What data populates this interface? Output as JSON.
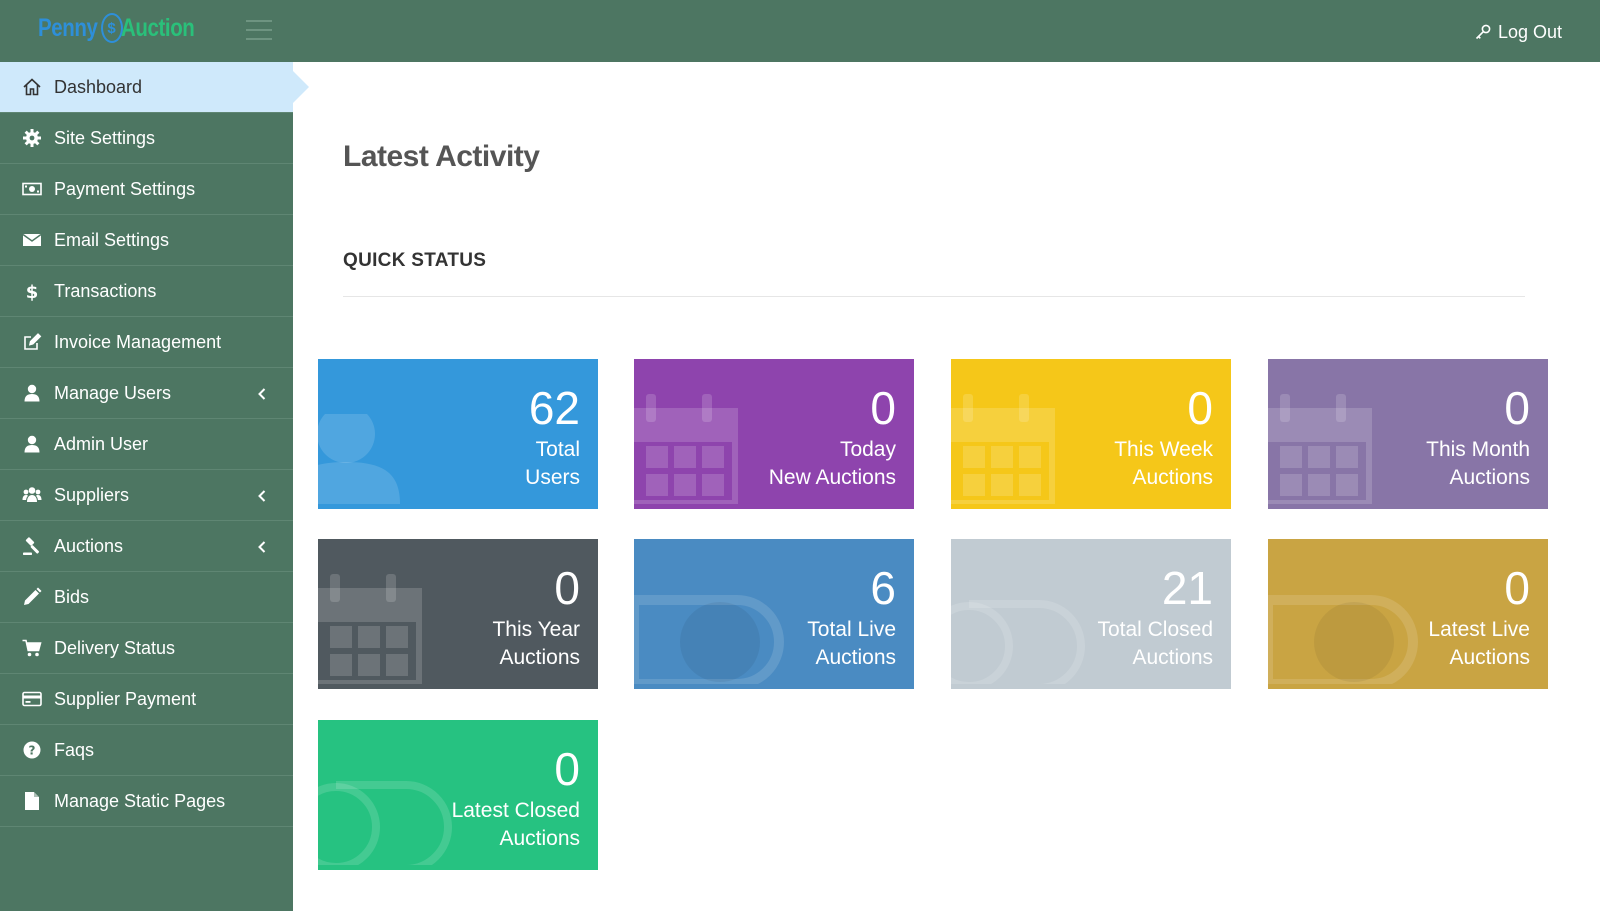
{
  "app": {
    "logo": {
      "word1": "Penny",
      "coin": "$",
      "word2": "Auction"
    },
    "logout_label": "Log Out"
  },
  "sidebar": {
    "items": [
      {
        "label": "Dashboard",
        "icon": "home-icon",
        "active": true,
        "has_submenu": false
      },
      {
        "label": "Site Settings",
        "icon": "gear-icon",
        "active": false,
        "has_submenu": false
      },
      {
        "label": "Payment Settings",
        "icon": "money-icon",
        "active": false,
        "has_submenu": false
      },
      {
        "label": "Email Settings",
        "icon": "envelope-icon",
        "active": false,
        "has_submenu": false
      },
      {
        "label": "Transactions",
        "icon": "dollar-icon",
        "active": false,
        "has_submenu": false
      },
      {
        "label": "Invoice Management",
        "icon": "edit-icon",
        "active": false,
        "has_submenu": false
      },
      {
        "label": "Manage Users",
        "icon": "user-icon",
        "active": false,
        "has_submenu": true
      },
      {
        "label": "Admin User",
        "icon": "user-icon",
        "active": false,
        "has_submenu": false
      },
      {
        "label": "Suppliers",
        "icon": "users-icon",
        "active": false,
        "has_submenu": true
      },
      {
        "label": "Auctions",
        "icon": "gavel-icon",
        "active": false,
        "has_submenu": true
      },
      {
        "label": "Bids",
        "icon": "pencil-icon",
        "active": false,
        "has_submenu": false
      },
      {
        "label": "Delivery Status",
        "icon": "cart-icon",
        "active": false,
        "has_submenu": false
      },
      {
        "label": "Supplier Payment",
        "icon": "credit-card-icon",
        "active": false,
        "has_submenu": false
      },
      {
        "label": "Faqs",
        "icon": "question-circle-icon",
        "active": false,
        "has_submenu": false
      },
      {
        "label": "Manage Static Pages",
        "icon": "file-icon",
        "active": false,
        "has_submenu": false
      }
    ]
  },
  "main": {
    "title": "Latest Activity",
    "section_title": "QUICK STATUS",
    "tiles": [
      {
        "value": "62",
        "line1": "Total",
        "line2": "Users",
        "color": "#3498db",
        "icon": "user-icon"
      },
      {
        "value": "0",
        "line1": "Today",
        "line2": "New Auctions",
        "color": "#8e44ad",
        "icon": "calendar-icon"
      },
      {
        "value": "0",
        "line1": "This Week",
        "line2": "Auctions",
        "color": "#f5c719",
        "icon": "calendar-icon"
      },
      {
        "value": "0",
        "line1": "This Month",
        "line2": "Auctions",
        "color": "#8875a7",
        "icon": "calendar-icon"
      },
      {
        "value": "0",
        "line1": "This Year",
        "line2": "Auctions",
        "color": "#50595f",
        "icon": "calendar-icon"
      },
      {
        "value": "6",
        "line1": "Total Live",
        "line2": "Auctions",
        "color": "#4a8bc2",
        "icon": "toggle-on-icon"
      },
      {
        "value": "21",
        "line1": "Total Closed",
        "line2": "Auctions",
        "color": "#c1cbd2",
        "icon": "toggle-off-icon"
      },
      {
        "value": "0",
        "line1": "Latest Live",
        "line2": "Auctions",
        "color": "#c9a443",
        "icon": "toggle-on-icon"
      },
      {
        "value": "0",
        "line1": "Latest Closed",
        "line2": "Auctions",
        "color": "#26c281",
        "icon": "toggle-off-icon"
      }
    ]
  }
}
